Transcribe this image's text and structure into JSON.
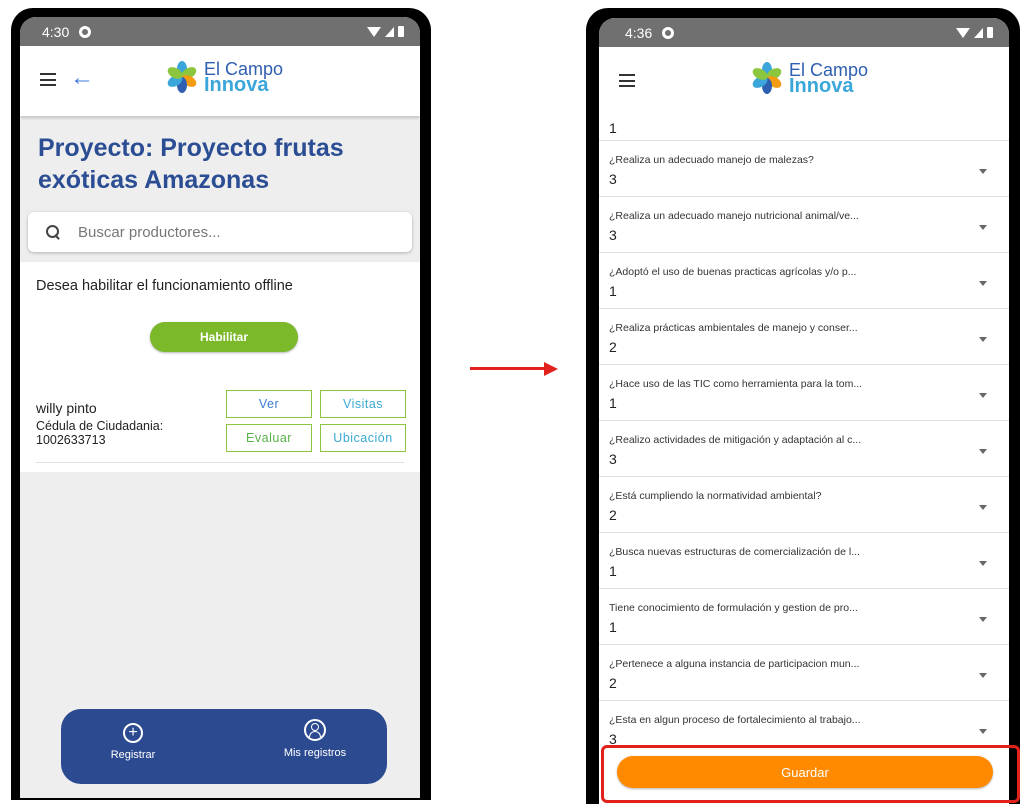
{
  "left_phone": {
    "status": {
      "time": "4:30"
    },
    "app": {
      "logo_line1": "El Campo",
      "logo_line2": "Innova"
    },
    "project_title": "Proyecto: Proyecto frutas exóticas Amazonas",
    "search": {
      "placeholder": "Buscar productores..."
    },
    "offline_prompt": "Desea habilitar el funcionamiento offline",
    "enable_button": "Habilitar",
    "producer": {
      "name": "willy pinto",
      "id_label": "Cédula de Ciudadania:",
      "id_number": "1002633713",
      "actions": {
        "view": "Ver",
        "visits": "Visitas",
        "evaluate": "Evaluar",
        "location": "Ubicación"
      }
    },
    "bottom_nav": {
      "register": "Registrar",
      "my_records": "Mis registros"
    }
  },
  "right_phone": {
    "status": {
      "time": "4:36"
    },
    "app": {
      "logo_line1": "El Campo",
      "logo_line2": "Innova"
    },
    "first_value": "1",
    "questions": [
      {
        "label": "¿Realiza un adecuado manejo de malezas?",
        "value": "3"
      },
      {
        "label": "¿Realiza un adecuado manejo nutricional animal/ve...",
        "value": "3"
      },
      {
        "label": "¿Adoptó el uso de buenas practicas agrícolas y/o p...",
        "value": "1"
      },
      {
        "label": "¿Realiza prácticas ambientales de manejo y conser...",
        "value": "2"
      },
      {
        "label": "¿Hace uso de las TIC como herramienta para la tom...",
        "value": "1"
      },
      {
        "label": "¿Realizo actividades de mitigación y adaptación al c...",
        "value": "3"
      },
      {
        "label": "¿Está cumpliendo la normatividad ambiental?",
        "value": "2"
      },
      {
        "label": "¿Busca nuevas estructuras de comercialización de l...",
        "value": "1"
      },
      {
        "label": "Tiene conocimiento de formulación y gestion de pro...",
        "value": "1"
      },
      {
        "label": "¿Pertenece a alguna instancia de participacion mun...",
        "value": "2"
      },
      {
        "label": "¿Esta en algun proceso de fortalecimiento al trabajo...",
        "value": "3"
      }
    ],
    "save_button": "Guardar"
  },
  "colors": {
    "primary_blue": "#2c4a90",
    "title_blue": "#2a4d93",
    "green": "#7bb82a",
    "orange": "#ff8a00",
    "annotation_red": "#e3211c"
  }
}
